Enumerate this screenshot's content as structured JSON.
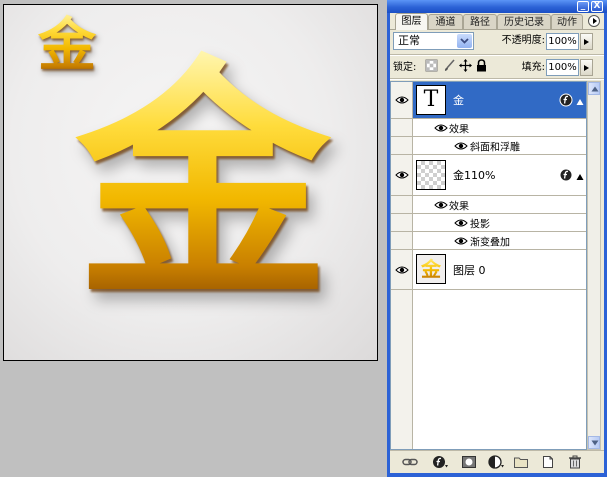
{
  "canvas": {
    "logo_char": "金",
    "main_char": "金"
  },
  "panel": {
    "window_buttons": {
      "minimize": "_",
      "close": "X"
    },
    "tabs": [
      {
        "label": "图层",
        "active": true
      },
      {
        "label": "通道",
        "active": false
      },
      {
        "label": "路径",
        "active": false
      },
      {
        "label": "历史记录",
        "active": false
      },
      {
        "label": "动作",
        "active": false
      }
    ],
    "blend_mode": "正常",
    "opacity_label": "不透明度:",
    "opacity_value": "100%",
    "lock_label": "锁定:",
    "fill_label": "填充:",
    "fill_value": "100%",
    "lock_icons": [
      "lock-transparency-icon",
      "lock-image-icon",
      "lock-position-icon",
      "lock-all-icon"
    ],
    "layers": [
      {
        "name": "金",
        "thumbnail_text": "T",
        "selected": true,
        "visible": true,
        "effects_label": "效果",
        "effects": [
          "斜面和浮雕"
        ]
      },
      {
        "name": "金110%",
        "selected": false,
        "visible": true,
        "effects_label": "效果",
        "effects": [
          "投影",
          "渐变叠加"
        ]
      },
      {
        "name": "图层 0",
        "thumbnail_char": "金",
        "selected": false,
        "visible": true
      }
    ],
    "footer_icons": [
      "link-layers-icon",
      "layer-style-icon",
      "layer-mask-icon",
      "adjustment-layer-icon",
      "new-group-icon",
      "new-layer-icon",
      "delete-layer-icon"
    ]
  },
  "colors": {
    "selection": "#316ac5",
    "title_bar": "#2c62d6",
    "gold": "#f2b800"
  }
}
